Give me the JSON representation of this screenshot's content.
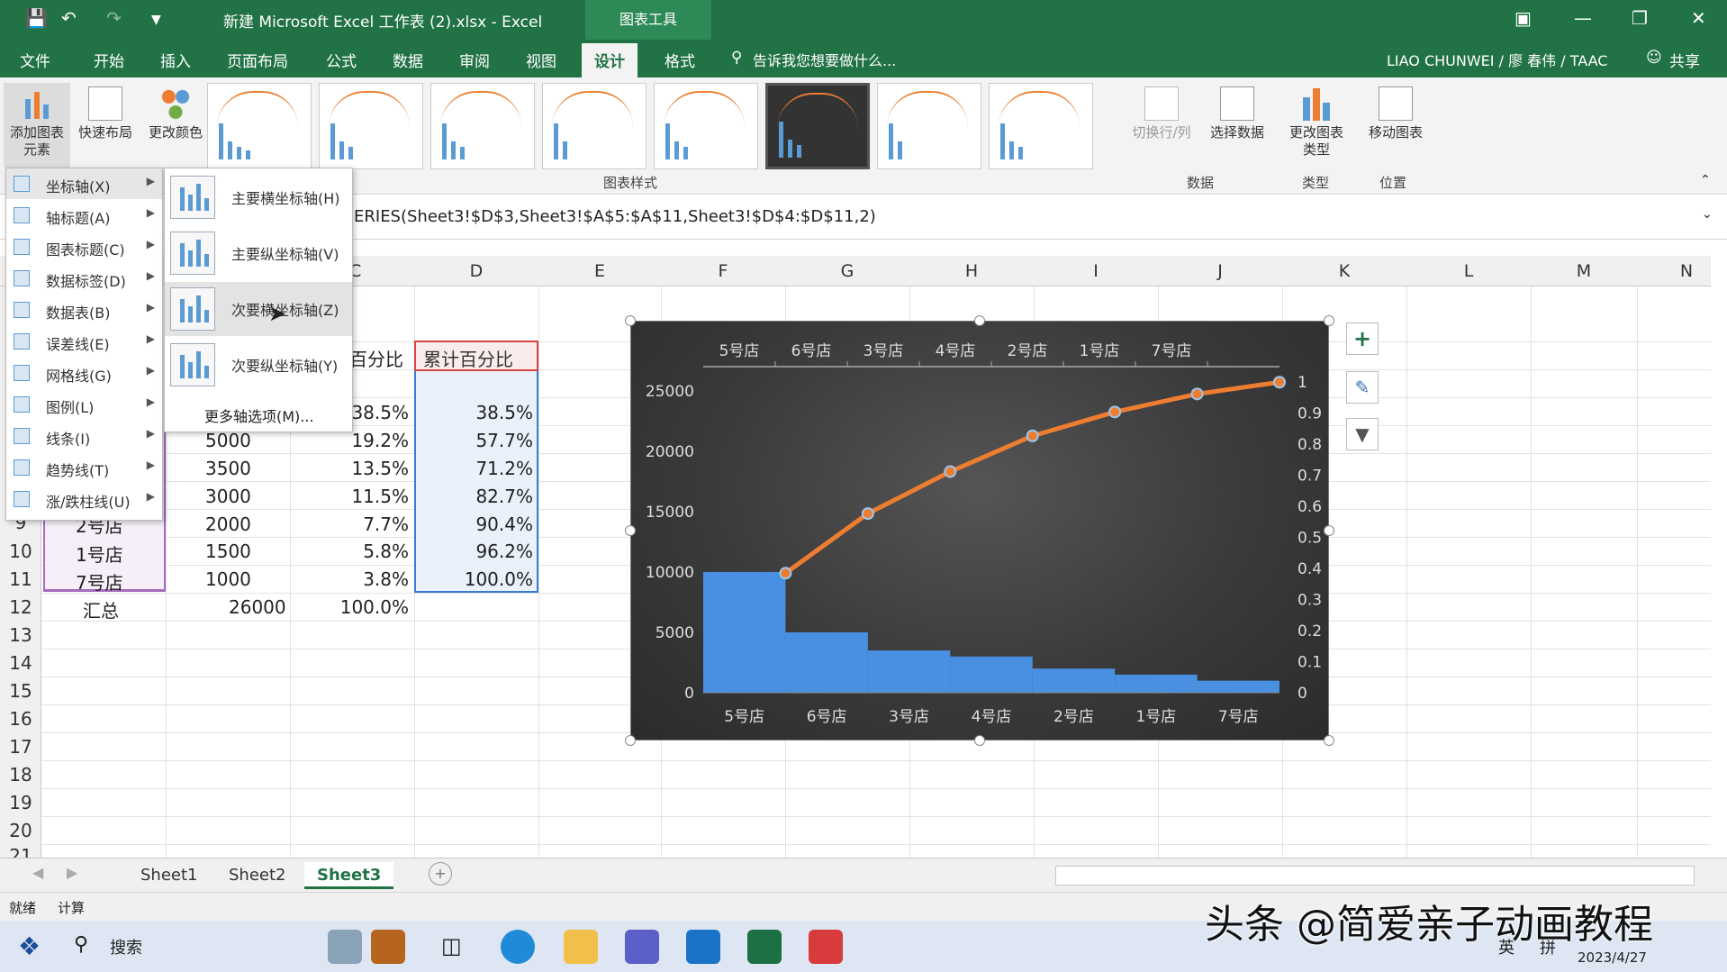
{
  "window": {
    "title": "新建 Microsoft Excel 工作表 (2).xlsx - Excel",
    "context_tab": "图表工具",
    "user": "LIAO CHUNWEI / 廖 春伟 / TAAC",
    "share": "共享"
  },
  "tabs": [
    "文件",
    "开始",
    "插入",
    "页面布局",
    "公式",
    "数据",
    "审阅",
    "视图",
    "设计",
    "格式"
  ],
  "active_tab": "设计",
  "tell_me": "告诉我您想要做什么...",
  "ribbon": {
    "add_element": "添加图表元素",
    "quick_layout": "快速布局",
    "change_colors": "更改颜色",
    "styles_group": "图表样式",
    "switch_rowcol": "切换行/列",
    "select_data": "选择数据",
    "data_group": "数据",
    "change_type": "更改图表类型",
    "type_group": "类型",
    "move_chart": "移动图表",
    "location_group": "位置"
  },
  "formula": "ERIES(Sheet3!$D$3,Sheet3!$A$5:$A$11,Sheet3!$D$4:$D$11,2)",
  "columns": [
    "C",
    "D",
    "E",
    "F",
    "G",
    "H",
    "I",
    "J",
    "K",
    "L",
    "M",
    "N"
  ],
  "rows": [
    "9",
    "10",
    "11",
    "12",
    "13",
    "14",
    "15",
    "16",
    "17",
    "18",
    "19",
    "20",
    "21"
  ],
  "table": {
    "c_header_partial": "百分比",
    "d_header": "累计百分比",
    "store_col": [
      "2号店",
      "1号店",
      "7号店",
      "汇总"
    ],
    "sales": [
      "5000",
      "3500",
      "3000",
      "2000",
      "1500",
      "1000",
      "26000"
    ],
    "pct": [
      "38.5%",
      "19.2%",
      "13.5%",
      "11.5%",
      "7.7%",
      "5.8%",
      "3.8%",
      "100.0%"
    ],
    "cum": [
      "38.5%",
      "57.7%",
      "71.2%",
      "82.7%",
      "90.4%",
      "96.2%",
      "100.0%"
    ]
  },
  "menu": {
    "items": [
      "坐标轴(X)",
      "轴标题(A)",
      "图表标题(C)",
      "数据标签(D)",
      "数据表(B)",
      "误差线(E)",
      "网格线(G)",
      "图例(L)",
      "线条(I)",
      "趋势线(T)",
      "涨/跌柱线(U)"
    ],
    "sub": [
      "主要横坐标轴(H)",
      "主要纵坐标轴(V)",
      "次要横坐标轴(Z)",
      "次要纵坐标轴(Y)"
    ],
    "more": "更多轴选项(M)..."
  },
  "chart_data": {
    "type": "bar",
    "categories": [
      "5号店",
      "6号店",
      "3号店",
      "4号店",
      "2号店",
      "1号店",
      "7号店"
    ],
    "series": [
      {
        "kind": "bar",
        "axis": "primary",
        "values": [
          10000,
          5000,
          3500,
          3000,
          2000,
          1500,
          1000
        ]
      },
      {
        "kind": "line",
        "axis": "secondary",
        "values": [
          0.385,
          0.577,
          0.712,
          0.827,
          0.904,
          0.962,
          1.0
        ]
      }
    ],
    "y_ticks": [
      "25000",
      "20000",
      "15000",
      "10000",
      "5000",
      "0"
    ],
    "y2_ticks": [
      "1",
      "0.9",
      "0.8",
      "0.7",
      "0.6",
      "0.5",
      "0.4",
      "0.3",
      "0.2",
      "0.1",
      "0"
    ],
    "ylim": [
      0,
      27000
    ],
    "y2lim": [
      0,
      1.05
    ],
    "colors": {
      "bar": "#4a90e2",
      "line": "#ed7d31"
    }
  },
  "sheets": [
    "Sheet1",
    "Sheet2",
    "Sheet3"
  ],
  "active_sheet": "Sheet3",
  "status": {
    "ready": "就绪",
    "calc": "计算"
  },
  "taskbar": {
    "search": "搜索",
    "date": "2023/4/27",
    "ime": "英",
    "ime2": "拼"
  },
  "watermark": "头条 @简爱亲子动画教程"
}
